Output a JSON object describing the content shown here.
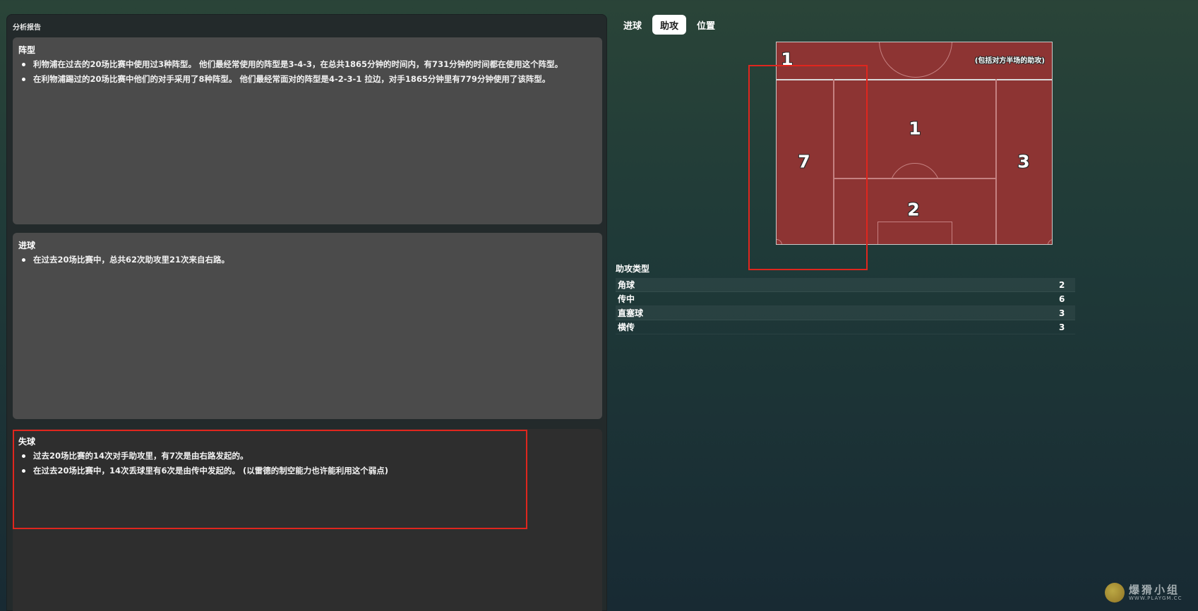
{
  "report": {
    "title": "分析报告",
    "formation": {
      "heading": "阵型",
      "items": [
        "利物浦在过去的20场比赛中使用过3种阵型。 他们最经常使用的阵型是3-4-3，在总共1865分钟的时间内，有731分钟的时间都在使用这个阵型。",
        "在利物浦踢过的20场比赛中他们的对手采用了8种阵型。 他们最经常面对的阵型是4-2-3-1 拉边，对手1865分钟里有779分钟使用了该阵型。"
      ]
    },
    "goals": {
      "heading": "进球",
      "items": [
        "在过去20场比赛中，总共62次助攻里21次来自右路。"
      ]
    },
    "conceded": {
      "heading": "失球",
      "items": [
        "过去20场比赛的14次对手助攻里，有7次是由右路发起的。",
        "在过去20场比赛中，14次丢球里有6次是由传中发起的。 (以雷德的制空能力也许能利用这个弱点)"
      ]
    }
  },
  "tabs": [
    {
      "label": "进球",
      "active": false
    },
    {
      "label": "助攻",
      "active": true
    },
    {
      "label": "位置",
      "active": false
    }
  ],
  "pitch": {
    "note": "(包括对方半场的助攻)",
    "zones": {
      "top_left": "1",
      "left": "7",
      "center_top": "1",
      "right": "3",
      "center_bottom": "2"
    },
    "colors": {
      "pitch": "#8d3433",
      "highlight": "#e0261e"
    }
  },
  "assists": {
    "title": "助攻类型",
    "rows": [
      {
        "label": "角球",
        "value": "2"
      },
      {
        "label": "传中",
        "value": "6"
      },
      {
        "label": "直塞球",
        "value": "3"
      },
      {
        "label": "横传",
        "value": "3"
      }
    ]
  },
  "watermark": {
    "text": "爆猾小组",
    "sub": "WWW.PLAYGM.CC"
  }
}
